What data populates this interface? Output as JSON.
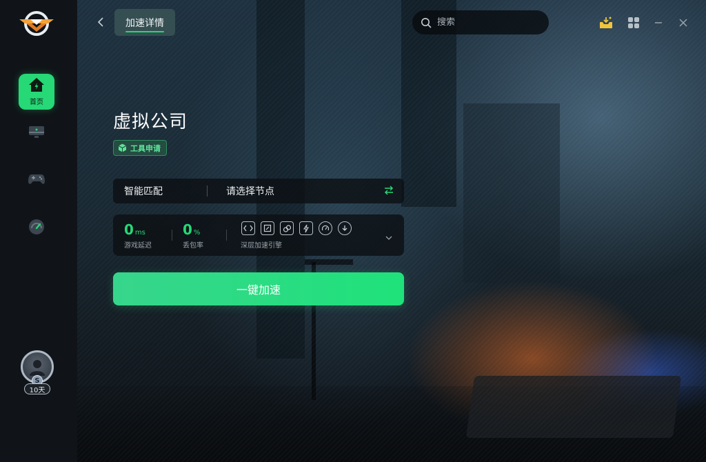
{
  "header": {
    "tab_label": "加速详情",
    "search_placeholder": "搜索"
  },
  "sidebar": {
    "items": [
      {
        "name": "home",
        "label": "首页",
        "active": true
      },
      {
        "name": "monitor",
        "label": ""
      },
      {
        "name": "gamepad",
        "label": ""
      },
      {
        "name": "speed",
        "label": ""
      }
    ],
    "user": {
      "level_badge": "S",
      "days_label": "10天"
    }
  },
  "game": {
    "title": "虚拟公司",
    "tag": "工具申请"
  },
  "node_bar": {
    "mode": "智能匹配",
    "node_placeholder": "请选择节点"
  },
  "stats": {
    "latency_value": "0",
    "latency_unit": "ms",
    "latency_label": "游戏延迟",
    "loss_value": "0",
    "loss_unit": "%",
    "loss_label": "丢包率",
    "engine_label": "深层加速引擎"
  },
  "actions": {
    "boost_label": "一键加速"
  },
  "colors": {
    "accent": "#26d876",
    "sidebar_bg": "#101418",
    "panel_bg": "#0c1014"
  }
}
